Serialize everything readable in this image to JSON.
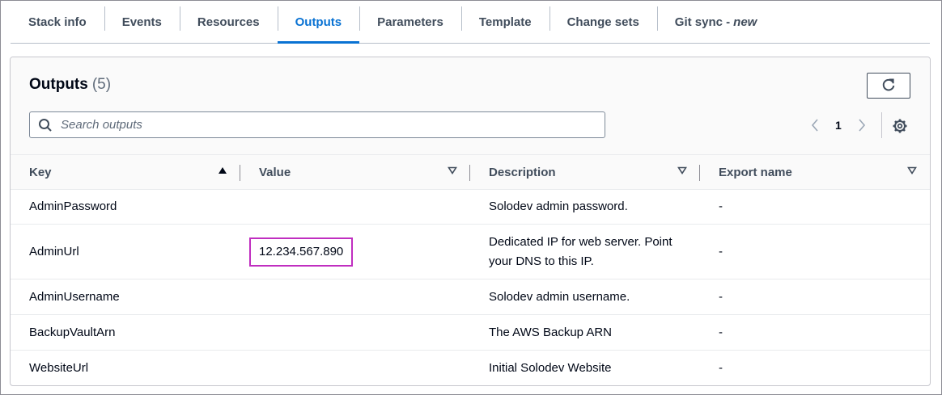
{
  "tabs": [
    {
      "label": "Stack info"
    },
    {
      "label": "Events"
    },
    {
      "label": "Resources"
    },
    {
      "label": "Outputs",
      "active": true
    },
    {
      "label": "Parameters"
    },
    {
      "label": "Template"
    },
    {
      "label": "Change sets"
    },
    {
      "label": "Git sync -",
      "suffix": "new"
    }
  ],
  "outputs": {
    "title": "Outputs",
    "count": "(5)",
    "search_placeholder": "Search outputs",
    "page": "1",
    "columns": {
      "key": "Key",
      "value": "Value",
      "description": "Description",
      "export_name": "Export name"
    },
    "rows": [
      {
        "key": "AdminPassword",
        "value": "",
        "description": "Solodev admin password.",
        "export": "-"
      },
      {
        "key": "AdminUrl",
        "value": "12.234.567.890",
        "description": "Dedicated IP for web server. Point your DNS to this IP.",
        "export": "-"
      },
      {
        "key": "AdminUsername",
        "value": "",
        "description": "Solodev admin username.",
        "export": "-"
      },
      {
        "key": "BackupVaultArn",
        "value": "",
        "description": "The AWS Backup ARN",
        "export": "-"
      },
      {
        "key": "WebsiteUrl",
        "value": "",
        "description": "Initial Solodev Website",
        "export": "-"
      }
    ]
  },
  "colors": {
    "accent": "#0972d3",
    "highlight_border": "#c02ec0"
  },
  "icons": {
    "refresh": "refresh-icon",
    "search": "search-icon",
    "prev": "chevron-left-icon",
    "next": "chevron-right-icon",
    "settings": "gear-icon",
    "sort_asc": "caret-up-icon",
    "sort_desc": "caret-down-outline-icon"
  }
}
